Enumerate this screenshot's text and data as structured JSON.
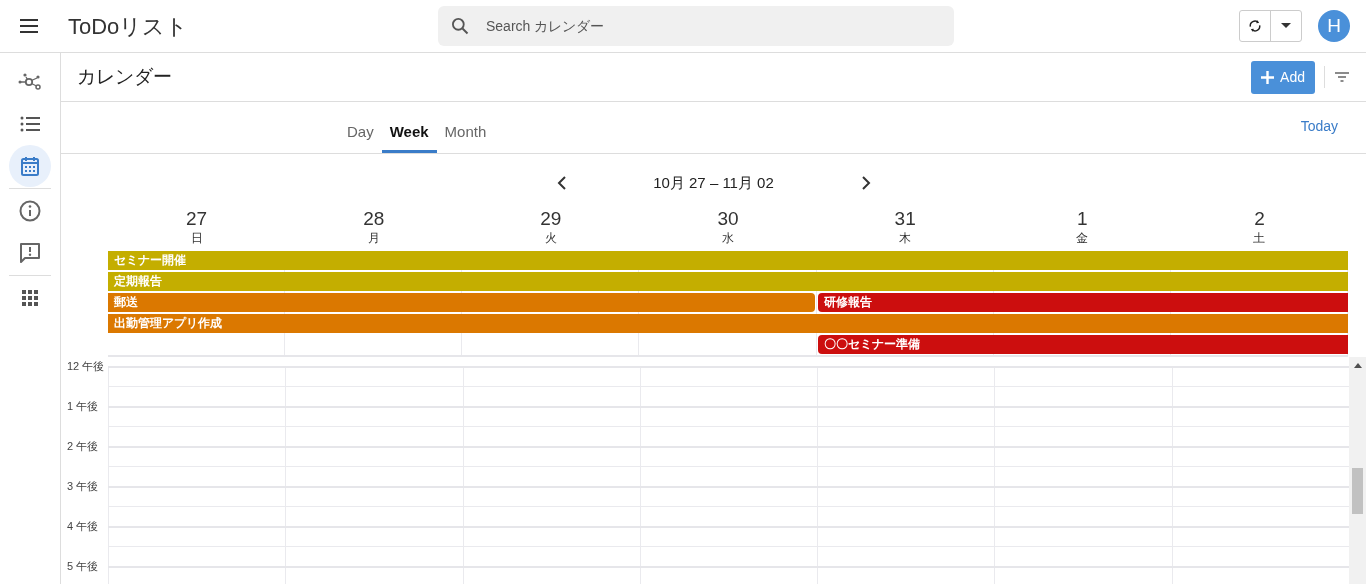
{
  "app_bar": {
    "title": "ToDoリスト",
    "search": {
      "placeholder": "Search カレンダー"
    },
    "avatar": "H"
  },
  "sidebar": {
    "groups": [
      [
        {
          "selected": false
        },
        {
          "selected": false
        },
        {
          "selected": true
        }
      ],
      [
        {
          "selected": false
        },
        {
          "selected": false
        }
      ],
      [
        {
          "selected": false
        }
      ]
    ]
  },
  "page": {
    "title": "カレンダー",
    "add_button": "Add"
  },
  "view_tabs": [
    {
      "label": "Day",
      "selected": false
    },
    {
      "label": "Week",
      "selected": true
    },
    {
      "label": "Month",
      "selected": false
    }
  ],
  "today_button": "Today",
  "range": "10月 27 – 11月 02",
  "days": [
    {
      "date": "27",
      "weekday": "日"
    },
    {
      "date": "28",
      "weekday": "月"
    },
    {
      "date": "29",
      "weekday": "火"
    },
    {
      "date": "30",
      "weekday": "水"
    },
    {
      "date": "31",
      "weekday": "木"
    },
    {
      "date": "1",
      "weekday": "金"
    },
    {
      "date": "2",
      "weekday": "土"
    }
  ],
  "all_day_rows": [
    [
      {
        "title": "セミナー開催",
        "color": "#c4ae00"
      }
    ],
    [
      {
        "title": "定期報告",
        "color": "#c4ae00"
      }
    ],
    [
      {
        "title": "郵送",
        "color": "#db7800"
      },
      {
        "title": "研修報告",
        "color": "#cc0e0e"
      }
    ],
    [
      {
        "title": "出勤管理アプリ作成",
        "color": "#db7800"
      }
    ],
    [
      {
        "title": "〇〇セミナー準備",
        "color": "#cc0e0e"
      }
    ]
  ],
  "hours": [
    "12 午後",
    "1 午後",
    "2 午後",
    "3 午後",
    "4 午後",
    "5 午後"
  ]
}
